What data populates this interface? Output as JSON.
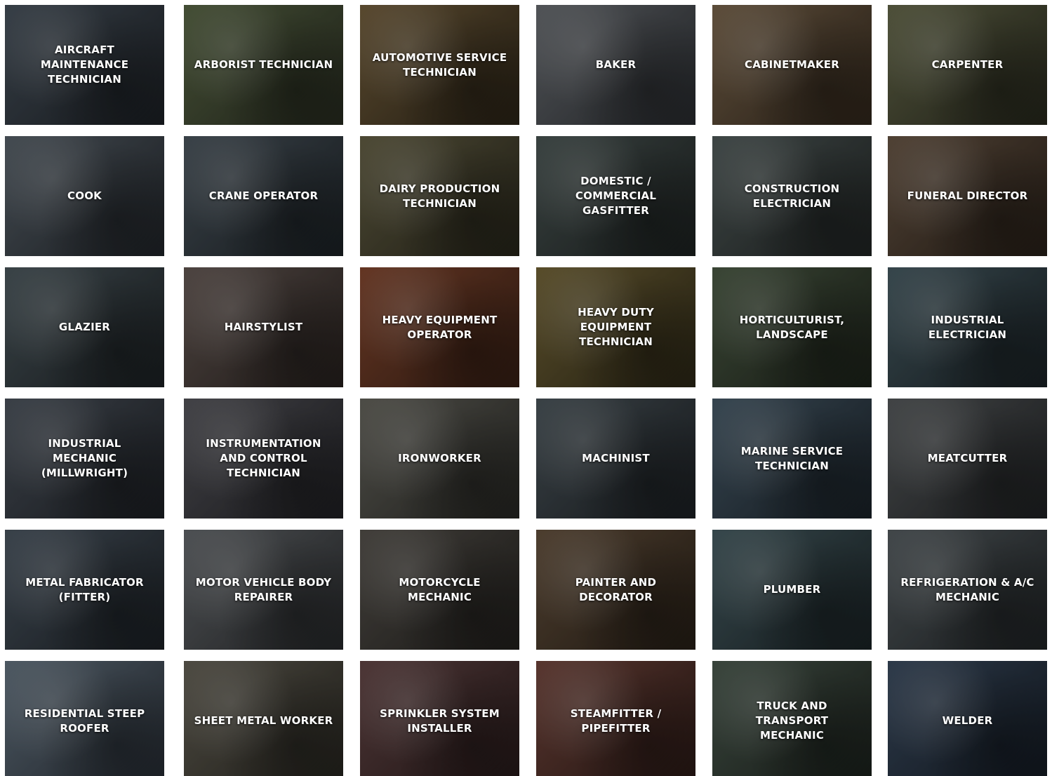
{
  "tiles": [
    {
      "label": "AIRCRAFT\nMAINTENANCE\nTECHNICIAN",
      "c1": "#4a5560",
      "c2": "#1f2328"
    },
    {
      "label": "ARBORIST TECHNICIAN",
      "c1": "#5d6b48",
      "c2": "#2a2e22"
    },
    {
      "label": "AUTOMOTIVE SERVICE\nTECHNICIAN",
      "c1": "#7a6440",
      "c2": "#2e2618"
    },
    {
      "label": "BAKER",
      "c1": "#6f7378",
      "c2": "#2c2f33"
    },
    {
      "label": "CABINETMAKER",
      "c1": "#806a50",
      "c2": "#34291d"
    },
    {
      "label": "CARPENTER",
      "c1": "#6b6e4e",
      "c2": "#2a2b1f"
    },
    {
      "label": "COOK",
      "c1": "#5d6770",
      "c2": "#23272c"
    },
    {
      "label": "CRANE OPERATOR",
      "c1": "#4f5a63",
      "c2": "#1e2428"
    },
    {
      "label": "DAIRY PRODUCTION\nTECHNICIAN",
      "c1": "#6a6548",
      "c2": "#2a281c"
    },
    {
      "label": "DOMESTIC /\nCOMMERCIAL\nGASFITTER",
      "c1": "#4e5a58",
      "c2": "#1f2423"
    },
    {
      "label": "CONSTRUCTION\nELECTRICIAN",
      "c1": "#55605f",
      "c2": "#222625"
    },
    {
      "label": "FUNERAL DIRECTOR",
      "c1": "#6e5a48",
      "c2": "#2b221a"
    },
    {
      "label": "GLAZIER",
      "c1": "#4f5c62",
      "c2": "#1e2326"
    },
    {
      "label": "HAIRSTYLIST",
      "c1": "#6a5d58",
      "c2": "#2a2320"
    },
    {
      "label": "HEAVY EQUIPMENT\nOPERATOR",
      "c1": "#8a4a30",
      "c2": "#3a2116"
    },
    {
      "label": "HEAVY DUTY\nEQUIPMENT\nTECHNICIAN",
      "c1": "#7a6a3a",
      "c2": "#2f2a18"
    },
    {
      "label": "HORTICULTURIST,\nLANDSCAPE",
      "c1": "#4f5f48",
      "c2": "#1f251c"
    },
    {
      "label": "INDUSTRIAL\nELECTRICIAN",
      "c1": "#4a6068",
      "c2": "#1c2428"
    },
    {
      "label": "INDUSTRIAL\nMECHANIC\n(MILLWRIGHT)",
      "c1": "#505862",
      "c2": "#1f2227"
    },
    {
      "label": "INSTRUMENTATION\nAND CONTROL\nTECHNICIAN",
      "c1": "#5a5a60",
      "c2": "#222226"
    },
    {
      "label": "IRONWORKER",
      "c1": "#6b6a62",
      "c2": "#2a2a26"
    },
    {
      "label": "MACHINIST",
      "c1": "#4f5a60",
      "c2": "#1e2226"
    },
    {
      "label": "MARINE SERVICE\nTECHNICIAN",
      "c1": "#4a5f6e",
      "c2": "#1c242b"
    },
    {
      "label": "MEATCUTTER",
      "c1": "#5a5e60",
      "c2": "#222426"
    },
    {
      "label": "METAL FABRICATOR\n(FITTER)",
      "c1": "#4e5a66",
      "c2": "#1e2328"
    },
    {
      "label": "MOTOR VEHICLE BODY\nREPAIRER",
      "c1": "#6a6e72",
      "c2": "#2a2c2e"
    },
    {
      "label": "MOTORCYCLE\nMECHANIC",
      "c1": "#5a5650",
      "c2": "#24221f"
    },
    {
      "label": "PAINTER AND\nDECORATOR",
      "c1": "#6a5540",
      "c2": "#2a2118"
    },
    {
      "label": "PLUMBER",
      "c1": "#4a6268",
      "c2": "#1c2528"
    },
    {
      "label": "REFRIGERATION & A/C\nMECHANIC",
      "c1": "#5a6266",
      "c2": "#222628"
    },
    {
      "label": "RESIDENTIAL STEEP\nROOFER",
      "c1": "#6a7a88",
      "c2": "#2a3038"
    },
    {
      "label": "SHEET METAL WORKER",
      "c1": "#6a665a",
      "c2": "#2a2822"
    },
    {
      "label": "SPRINKLER SYSTEM\nINSTALLER",
      "c1": "#6a4a4a",
      "c2": "#2a1c1c"
    },
    {
      "label": "STEAMFITTER /\nPIPEFITTER",
      "c1": "#7a4a40",
      "c2": "#2e1c18"
    },
    {
      "label": "TRUCK AND\nTRANSPORT\nMECHANIC",
      "c1": "#4e5e52",
      "c2": "#1e241f"
    },
    {
      "label": "WELDER",
      "c1": "#3e5066",
      "c2": "#161d26"
    }
  ]
}
